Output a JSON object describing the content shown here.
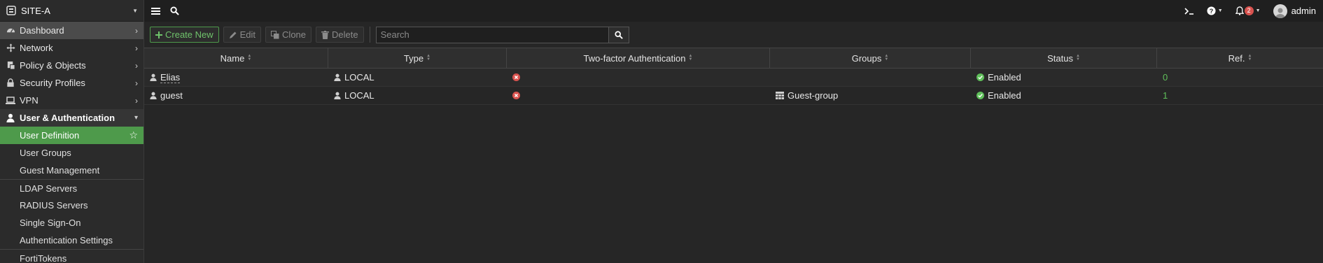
{
  "device": {
    "name": "SITE-A"
  },
  "sidebar": {
    "items": [
      {
        "label": "Dashboard",
        "icon": "dashboard-icon"
      },
      {
        "label": "Network",
        "icon": "network-icon"
      },
      {
        "label": "Policy & Objects",
        "icon": "policy-icon"
      },
      {
        "label": "Security Profiles",
        "icon": "lock-icon"
      },
      {
        "label": "VPN",
        "icon": "laptop-icon"
      },
      {
        "label": "User & Authentication",
        "icon": "user-icon"
      }
    ],
    "sub_items": [
      {
        "label": "User Definition"
      },
      {
        "label": "User Groups"
      },
      {
        "label": "Guest Management"
      },
      {
        "label": "LDAP Servers"
      },
      {
        "label": "RADIUS Servers"
      },
      {
        "label": "Single Sign-On"
      },
      {
        "label": "Authentication Settings"
      },
      {
        "label": "FortiTokens"
      }
    ]
  },
  "topbar": {
    "notification_count": "2",
    "user": "admin"
  },
  "toolbar": {
    "create_label": "Create New",
    "edit_label": "Edit",
    "clone_label": "Clone",
    "delete_label": "Delete",
    "search_placeholder": "Search"
  },
  "table": {
    "columns": [
      "Name",
      "Type",
      "Two-factor Authentication",
      "Groups",
      "Status",
      "Ref."
    ],
    "rows": [
      {
        "name": "Elias",
        "type": "LOCAL",
        "groups": "",
        "status": "Enabled",
        "ref": "0"
      },
      {
        "name": "guest",
        "type": "LOCAL",
        "groups": "Guest-group",
        "status": "Enabled",
        "ref": "1"
      }
    ]
  },
  "colors": {
    "accent": "#4e9a4b",
    "enabled": "#5fbf5a",
    "disabled": "#d9534f"
  }
}
